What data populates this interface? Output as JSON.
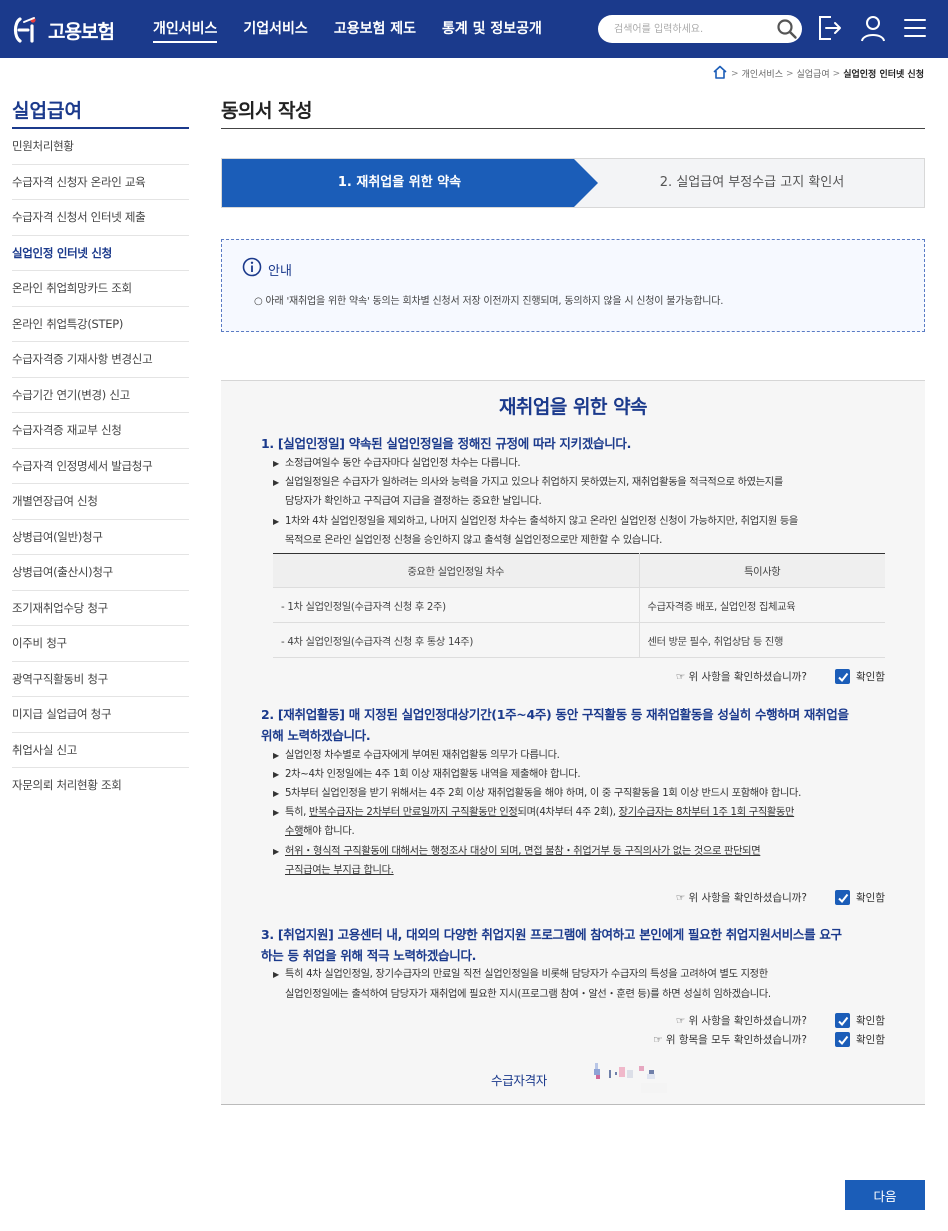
{
  "header": {
    "logo_text": "고용보험",
    "nav": [
      "개인서비스",
      "기업서비스",
      "고용보험 제도",
      "통계 및 정보공개"
    ],
    "search_placeholder": "검색어를 입력하세요.",
    "brand_color": "#1b3a8c"
  },
  "breadcrumb": {
    "items": [
      "개인서비스",
      "실업급여"
    ],
    "current": "실업인정 인터넷 신청"
  },
  "sidebar": {
    "title": "실업급여",
    "items": [
      "민원처리현황",
      "수급자격 신청자 온라인 교육",
      "수급자격 신청서 인터넷 제출",
      "실업인정 인터넷 신청",
      "온라인 취업희망카드 조회",
      "온라인 취업특강(STEP)",
      "수급자격증 기재사항 변경신고",
      "수급기간 연기(변경) 신고",
      "수급자격증 재교부 신청",
      "수급자격 인정명세서 발급청구",
      "개별연장급여 신청",
      "상병급여(일반)청구",
      "상병급여(출산시)청구",
      "조기재취업수당 청구",
      "이주비 청구",
      "광역구직활동비 청구",
      "미지급 실업급여 청구",
      "취업사실 신고",
      "자문의뢰 처리현황 조회"
    ],
    "active_index": 3
  },
  "page": {
    "title": "동의서 작성",
    "steps": [
      "1. 재취업을 위한 약속",
      "2. 실업급여 부정수급 고지 확인서"
    ],
    "notice_title": "안내",
    "notice_text": "○ 아래 '재취업을 위한 약속' 동의는 회차별 신청서 저장 이전까지 진행되며, 동의하지 않을 시 신청이 불가능합니다."
  },
  "agreement": {
    "title": "재취업을 위한 약속",
    "s1": {
      "head": "1. [실업인정일] 약속된 실업인정일을 정해진 규정에 따라 지키겠습니다.",
      "b1": "소정급여일수 동안 수급자마다 실업인정 차수는 다릅니다.",
      "b2a": "실업일정일은 수급자가 일하려는 의사와 능력을 가지고 있으나 취업하지 못하였는지, 재취업활동을 적극적으로 하였는지를",
      "b2b": "담당자가 확인하고 구직급여 지급을 결정하는 중요한 날입니다.",
      "b3a": "1차와 4차 실업인정일을 제외하고, 나머지 실업인정 차수는 출석하지 않고 온라인 실업인정 신청이 가능하지만, 취업지원 등을",
      "b3b": "목적으로 온라인 실업인정 신청을 승인하지 않고 출석형 실업인정으로만 제한할 수 있습니다.",
      "table": {
        "headers": [
          "중요한 실업인정일 차수",
          "특이사항"
        ],
        "rows": [
          [
            "- 1차 실업인정일(수급자격 신청 후 2주)",
            "수급자격증 배포, 실업인정 집체교육"
          ],
          [
            "- 4차 실업인정일(수급자격 신청 후 통상 14주)",
            "센터 방문 필수, 취업상담 등 진행"
          ]
        ]
      }
    },
    "s2": {
      "head1": "2. [재취업활동] 매 지정된 실업인정대상기간(1주~4주) 동안 구직활동 등 재취업활동을 성실히 수행하며 재취업을",
      "head2": "위해 노력하겠습니다.",
      "b1": "실업인정 차수별로 수급자에게 부여된 재취업활동 의무가 다릅니다.",
      "b2": "2차~4차 인정일에는 4주 1회 이상 재취업활동 내역을 제출해야 합니다.",
      "b3": "5차부터 실업인정을 받기 위해서는 4주 2회 이상 재취업활동을 해야 하며, 이 중 구직활동을 1회 이상 반드시 포함해야 합니다.",
      "b4_pre": "특히, ",
      "b4_u1": "반복수급자는 2차부터 만료일까지 구직활동만 인정",
      "b4_mid": "되며(4차부터 4주 2회), ",
      "b4_u2": "장기수급자는 8차부터 1주 1회 구직활동만",
      "b4_u3": "수행",
      "b4_end": "해야 합니다.",
      "b5_u1": "허위・형식적 구직활동에 대해서는 행정조사 대상이 되며, 면접 불참・취업거부 등 구직의사가 없는 것으로 판단되면",
      "b5_u2": "구직급여는 부지급 합니다."
    },
    "s3": {
      "head1": "3. [취업지원] 고용센터 내, 대외의 다양한 취업지원 프로그램에 참여하고 본인에게 필요한 취업지원서비스를 요구",
      "head2": "하는 등 취업을 위해 적극 노력하겠습니다.",
      "b1a": "특히 4차 실업인정일, 장기수급자의 만료일 직전 실업인정일을 비롯해 담당자가 수급자의 특성을 고려하여 별도 지정한",
      "b1b": "실업인정일에는 출석하여 담당자가 재취업에 필요한 지시(프로그램 참여・알선・훈련 등)를 하면 성실히 임하겠습니다."
    },
    "confirm_question": "☞ 위 사항을 확인하셨습니까?",
    "confirm_all_question": "☞ 위 항목을 모두 확인하셨습니까?",
    "confirm_label": "확인함",
    "signer_label": "수급자격자"
  },
  "next_button": "다음"
}
